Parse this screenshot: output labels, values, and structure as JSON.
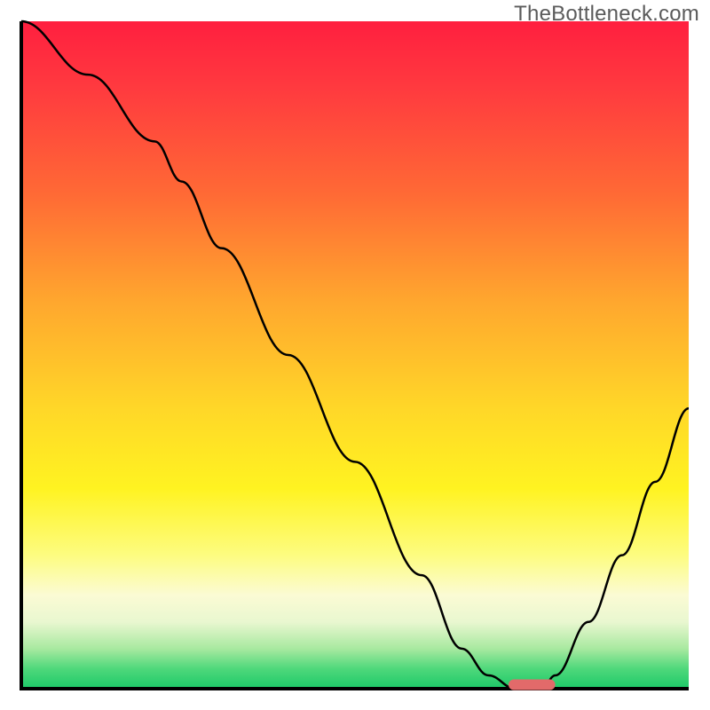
{
  "watermark": "TheBottleneck.com",
  "chart_data": {
    "type": "line",
    "title": "",
    "xlabel": "",
    "ylabel": "",
    "xlim": [
      0,
      100
    ],
    "ylim": [
      0,
      100
    ],
    "grid": false,
    "legend": false,
    "background_gradient": [
      "#ff1f3f",
      "#ffd728",
      "#fdfc80",
      "#1cc968"
    ],
    "series": [
      {
        "name": "bottleneck-curve",
        "x": [
          0,
          10,
          20,
          24,
          30,
          40,
          50,
          60,
          66,
          70,
          74,
          78,
          80,
          85,
          90,
          95,
          100
        ],
        "y": [
          100,
          92,
          82,
          76,
          66,
          50,
          34,
          17,
          6,
          2,
          0,
          0,
          2,
          10,
          20,
          31,
          42
        ]
      }
    ],
    "marker": {
      "name": "optimal-range",
      "x_start": 73,
      "x_end": 80,
      "y": 0.6,
      "color": "#e26a6a"
    }
  }
}
